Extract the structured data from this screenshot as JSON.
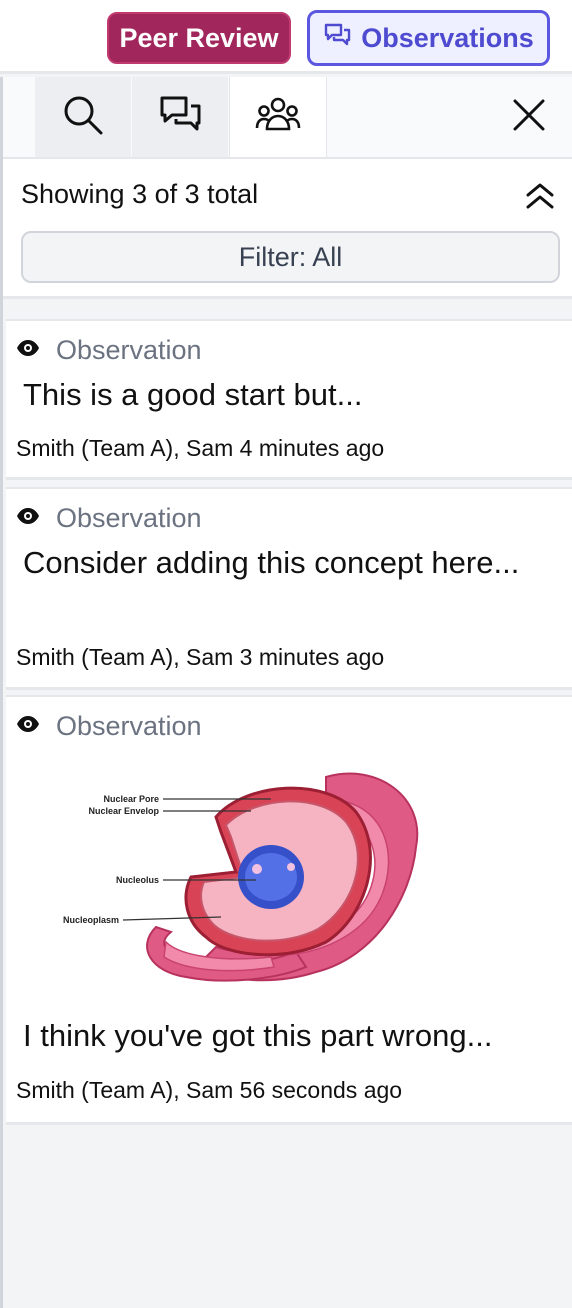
{
  "topbar": {
    "peer_review_label": "Peer Review",
    "observations_label": "Observations"
  },
  "toolbar": {
    "icons": [
      "search-icon",
      "chat-icon",
      "people-icon",
      "close-icon"
    ]
  },
  "summary": {
    "text": "Showing 3 of 3 total",
    "filter_label": "Filter: All"
  },
  "cards": [
    {
      "type": "Observation",
      "body": "This is a good start but...",
      "meta": "Smith (Team A), Sam 4 minutes ago"
    },
    {
      "type": "Observation",
      "body": "Consider adding this concept here...",
      "meta": "Smith (Team A), Sam 3 minutes ago"
    },
    {
      "type": "Observation",
      "figure_labels": [
        "Nuclear Pore",
        "Nuclear Envelop",
        "Nucleolus",
        "Nucleoplasm"
      ],
      "body": "I think you've got this part wrong...",
      "meta": "Smith (Team A), Sam 56 seconds ago"
    }
  ],
  "colors": {
    "peer_review_bg": "#a0265c",
    "observations_accent": "#5b57e0"
  }
}
